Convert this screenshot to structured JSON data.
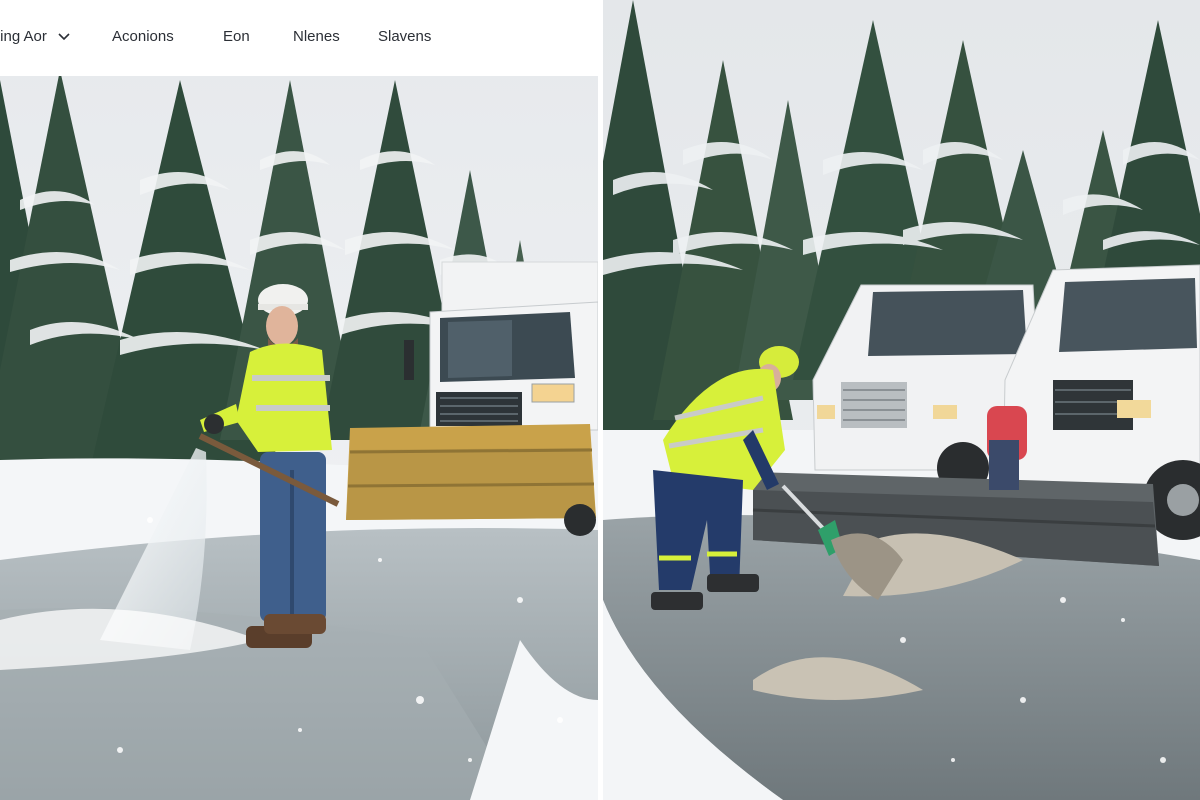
{
  "nav": {
    "items": [
      {
        "label": "ting Aor",
        "has_dropdown": true
      },
      {
        "label": "Aconions"
      },
      {
        "label": "Eon"
      },
      {
        "label": "Nlenes"
      },
      {
        "label": "Slavens"
      }
    ]
  },
  "colors": {
    "snow": "#f4f6f8",
    "wet_road": "#8c9599",
    "safety_vest": "#d7f03a",
    "plow_blade": "#c9a24a",
    "truck_white": "#f1f2f3",
    "pine_dark": "#2f4a3a"
  },
  "icons": [
    "chevron-down-icon"
  ]
}
